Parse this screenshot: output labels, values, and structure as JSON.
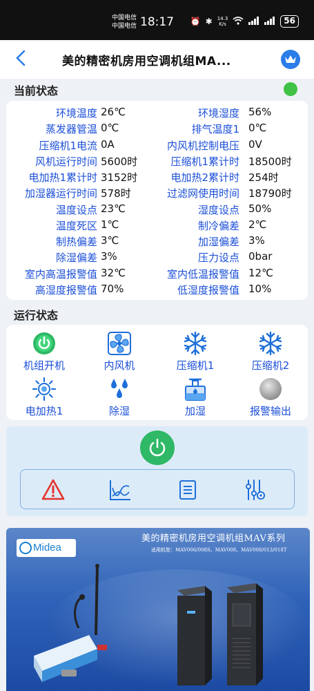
{
  "statusbar": {
    "carrier1": "中国电信",
    "carrier2": "中国电信",
    "time": "18:17",
    "speed_value": "14.3",
    "speed_unit": "K/s",
    "battery": "56"
  },
  "header": {
    "title": "美的精密机房用空调机组MA..."
  },
  "current_status": {
    "title": "当前状态",
    "indicator_color": "#3fc246",
    "rows": [
      {
        "l1": "环境温度",
        "v1": "26℃",
        "l2": "环境湿度",
        "v2": "56%"
      },
      {
        "l1": "蒸发器管温",
        "v1": "0℃",
        "l2": "排气温度1",
        "v2": "0℃"
      },
      {
        "l1": "压缩机1电流",
        "v1": "0A",
        "l2": "内风机控制电压",
        "v2": "0V"
      },
      {
        "l1": "风机运行时间",
        "v1": "5600时",
        "l2": "压缩机1累计时",
        "v2": "18500时"
      },
      {
        "l1": "电加热1累计时",
        "v1": "3152时",
        "l2": "电加热2累计时",
        "v2": "254时"
      },
      {
        "l1": "加湿器运行时间",
        "v1": "578时",
        "l2": "过滤网使用时间",
        "v2": "18790时"
      },
      {
        "l1": "温度设点",
        "v1": "23℃",
        "l2": "湿度设点",
        "v2": "50%"
      },
      {
        "l1": "温度死区",
        "v1": "1℃",
        "l2": "制冷偏差",
        "v2": "2℃"
      },
      {
        "l1": "制热偏差",
        "v1": "3℃",
        "l2": "加湿偏差",
        "v2": "3%"
      },
      {
        "l1": "除湿偏差",
        "v1": "3%",
        "l2": "压力设点",
        "v2": "0bar"
      },
      {
        "l1": "室内高温报警值",
        "v1": "32℃",
        "l2": "室内低温报警值",
        "v2": "12℃"
      },
      {
        "l1": "高湿度报警值",
        "v1": "70%",
        "l2": "低湿度报警值",
        "v2": "10%"
      }
    ]
  },
  "run_status": {
    "title": "运行状态",
    "items": [
      {
        "label": "机组开机",
        "icon": "power-on-icon"
      },
      {
        "label": "内风机",
        "icon": "fan-icon"
      },
      {
        "label": "压缩机1",
        "icon": "snowflake-icon"
      },
      {
        "label": "压缩机2",
        "icon": "snowflake-icon"
      },
      {
        "label": "电加热1",
        "icon": "sun-icon"
      },
      {
        "label": "除湿",
        "icon": "droplets-icon"
      },
      {
        "label": "加湿",
        "icon": "humidifier-icon"
      },
      {
        "label": "报警输出",
        "icon": "alarm-off-icon"
      }
    ]
  },
  "controls": {
    "tools": [
      "alarm-warning-icon",
      "trend-chart-icon",
      "document-list-icon",
      "settings-sliders-icon"
    ]
  },
  "banner": {
    "logo": "Midea",
    "title": "美的精密机房用空调机组MAV系列",
    "subtitle": "适用机型：MAV006/008S、MAV008、MAV008/013/018T"
  },
  "colors": {
    "accent": "#2b7de9",
    "label_blue": "#1b4fd8",
    "ok_green": "#2fb866"
  }
}
